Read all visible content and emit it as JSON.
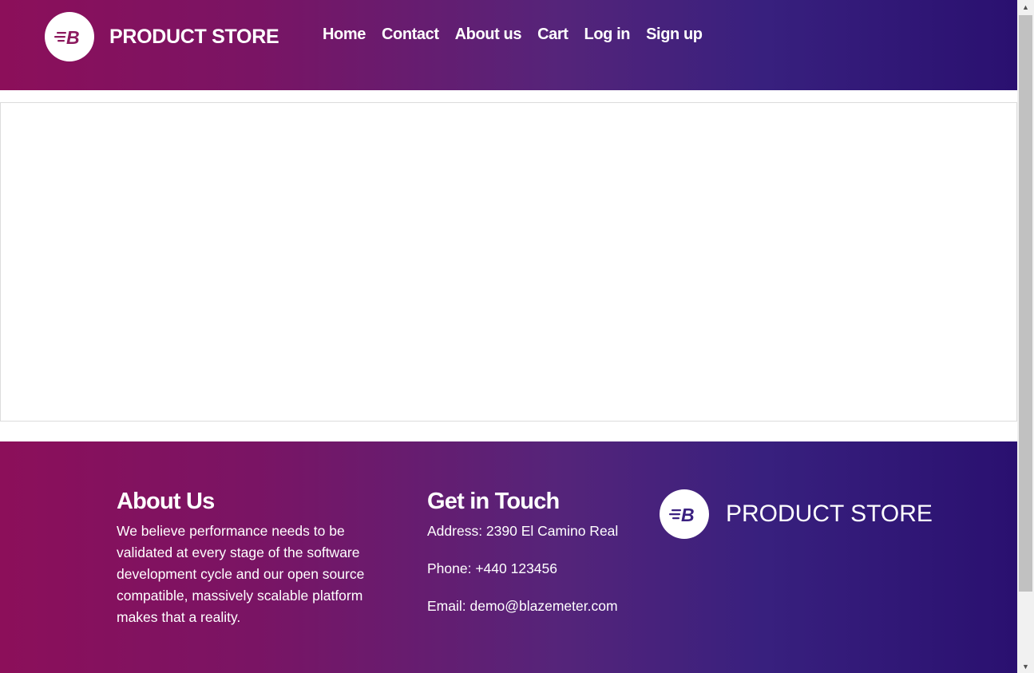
{
  "header": {
    "brand_name": "PRODUCT STORE",
    "logo_icon": "blazemeter-b-logo",
    "nav": [
      {
        "label": "Home"
      },
      {
        "label": "Contact"
      },
      {
        "label": "About us"
      },
      {
        "label": "Cart"
      },
      {
        "label": "Log in"
      },
      {
        "label": "Sign up"
      }
    ]
  },
  "footer": {
    "about": {
      "heading": "About Us",
      "text": "We believe performance needs to be validated at every stage of the software development cycle and our open source compatible, massively scalable platform makes that a reality."
    },
    "contact": {
      "heading": "Get in Touch",
      "address": "Address: 2390 El Camino Real",
      "phone": "Phone: +440 123456",
      "email": "Email: demo@blazemeter.com"
    },
    "brand_name": "PRODUCT STORE"
  },
  "colors": {
    "gradient_start": "#8c0f5a",
    "gradient_end": "#2a1070",
    "logo_mark": "#8c1a5e"
  }
}
